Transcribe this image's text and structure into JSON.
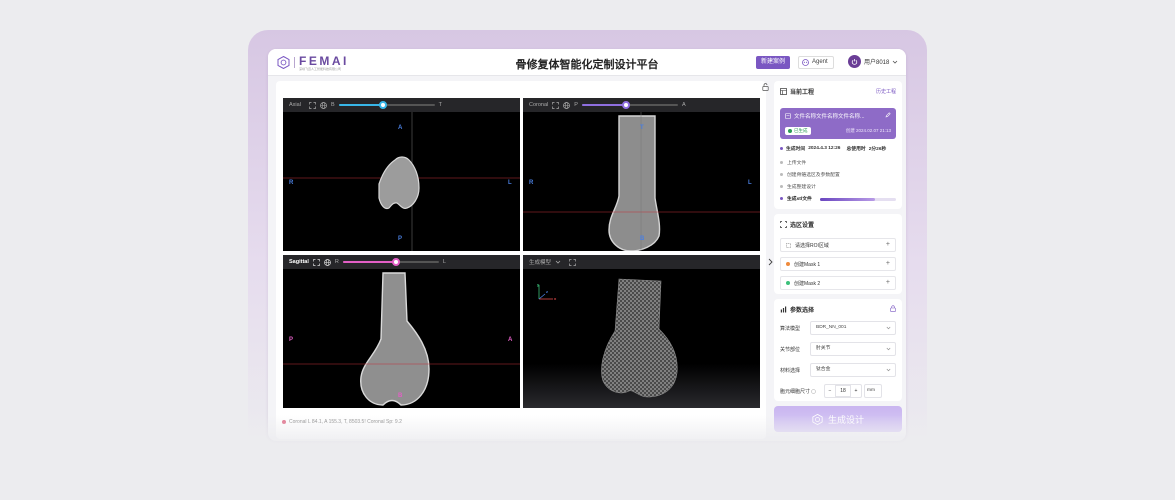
{
  "header": {
    "logo_text": "FEMAI",
    "logo_subtitle": "深圳飞迈人工智能科技有限公司",
    "title": "骨修复体智能化定制设计平台",
    "new_case_label": "新建案例",
    "agent_label": "Agent",
    "user_name": "用户8018"
  },
  "viewports": [
    {
      "name": "Axial",
      "start": "B",
      "end": "T",
      "slider_value": 0.46,
      "slider_color": "#38b6e8",
      "markers": {
        "top": "A",
        "bottom": "P",
        "left": "R",
        "right": "L"
      }
    },
    {
      "name": "Coronal",
      "start": "P",
      "end": "A",
      "slider_value": 0.46,
      "slider_color": "#8f6fe0",
      "markers": {
        "top": "T",
        "bottom": "B",
        "left": "R",
        "right": "L"
      }
    },
    {
      "name": "Sagittal",
      "start": "R",
      "end": "L",
      "slider_value": 0.55,
      "slider_color": "#e35fc6",
      "markers": {
        "top": "T",
        "bottom": "B",
        "left": "P",
        "right": "A"
      }
    },
    {
      "name": "生成模型",
      "axes": {
        "x": "x",
        "y": "y",
        "z": "z"
      }
    }
  ],
  "status_line": "Coronal L 84.1, A 155.3, T, 8503.5! Coronal Sp: 9.2",
  "project": {
    "title": "当前工程",
    "history_label": "历史工程",
    "file_name": "文件名称文件名称文件名称...",
    "status_tag": "已生成",
    "created": "创建 2024.02.07 21:13",
    "gen_time_label": "生成时间",
    "gen_time": "2024.4.3 12:26",
    "elapsed_label": "总使用时",
    "elapsed": "2分26秒",
    "steps": [
      "上传文件",
      "创建骨骼选区及参数配置",
      "生成整建设计",
      "生成stl文件"
    ],
    "progress": 0.72
  },
  "selection": {
    "title": "选区设置",
    "items": [
      {
        "label": "请选择ROI区域",
        "dot": ""
      },
      {
        "label": "创建Mask 1",
        "dot": "#ef8a3c"
      },
      {
        "label": "创建Mask 2",
        "dot": "#3cc07a"
      }
    ]
  },
  "params": {
    "title": "参数选择",
    "algo_label": "算法模型",
    "algo_value": "BDR_NN_001",
    "joint_label": "关节部位",
    "joint_value": "肘关节",
    "material_label": "材料选择",
    "material_value": "钛合金",
    "cell_label": "胞元细胞尺寸",
    "cell_value": "18",
    "cell_unit": "mm",
    "minus": "−",
    "plus": "+"
  },
  "generate_label": "生成设计",
  "colors": {
    "accent": "#7a57c2",
    "viewport_bg": "#000000"
  }
}
